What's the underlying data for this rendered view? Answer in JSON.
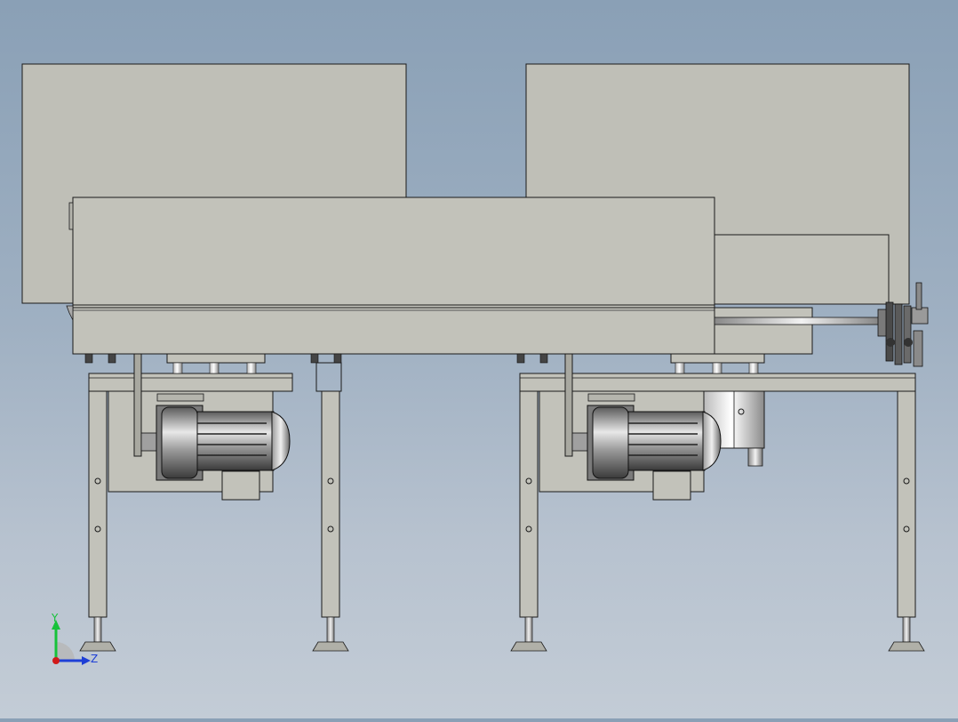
{
  "view": {
    "background_top": "#8aa0b6",
    "background_bottom": "#c3ccd6",
    "part_fill": "#bdbdb5",
    "edge_color": "#1a1a1a",
    "motor_color": "#8a8a8a"
  },
  "triad": {
    "y_label": "Y",
    "z_label": "Z",
    "y_color": "#16c23a",
    "z_color": "#1e3fd6",
    "origin_color": "#d11a1a"
  }
}
